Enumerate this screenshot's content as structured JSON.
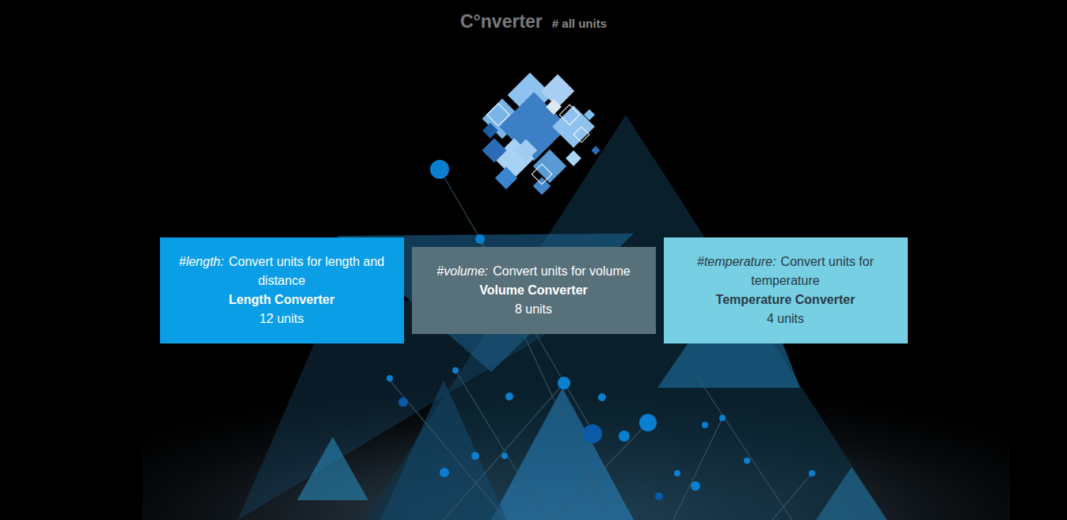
{
  "header": {
    "title": "C°nverter",
    "subtitle": "# all units"
  },
  "cards": [
    {
      "tag": "#length:",
      "description": "Convert units for length and distance",
      "title": "Length Converter",
      "count": "12 units",
      "color": "#0a9ee6"
    },
    {
      "tag": "#volume:",
      "description": "Convert units for volume",
      "title": "Volume Converter",
      "count": "8 units",
      "color": "#58707a"
    },
    {
      "tag": "#temperature:",
      "description": "Convert units for temperature",
      "title": "Temperature Converter",
      "count": "4 units",
      "color": "#76cfe3"
    }
  ]
}
